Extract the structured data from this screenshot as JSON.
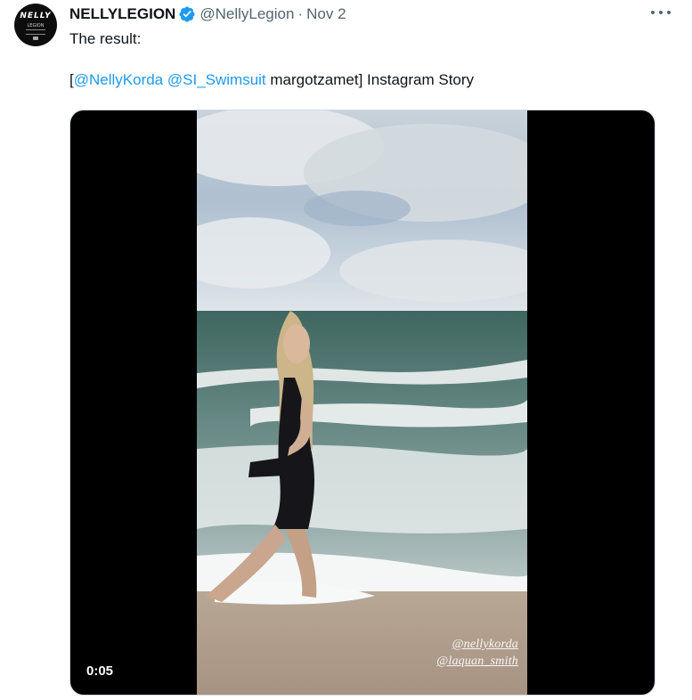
{
  "author": {
    "display_name": "NELLYLEGION",
    "handle": "@NellyLegion",
    "separator": "·",
    "timestamp": "Nov 2",
    "verified": true,
    "avatar_logo_text": "NELLY",
    "avatar_logo_sub": "LEGION"
  },
  "tweet": {
    "line1": "The result:",
    "open_bracket": "[",
    "mention1": "@NellyKorda",
    "space": " ",
    "mention2": "@SI_Swimsuit",
    "rest": " margotzamet] Instagram Story"
  },
  "media": {
    "duration": "0:05",
    "watermark1": "@nellykorda",
    "watermark2": "@laquan_smith"
  },
  "icons": {
    "verified": "verified-badge-icon",
    "more": "more-options-icon"
  },
  "colors": {
    "link": "#1d9bf0",
    "secondary_text": "#536471",
    "primary_text": "#0f1419"
  }
}
